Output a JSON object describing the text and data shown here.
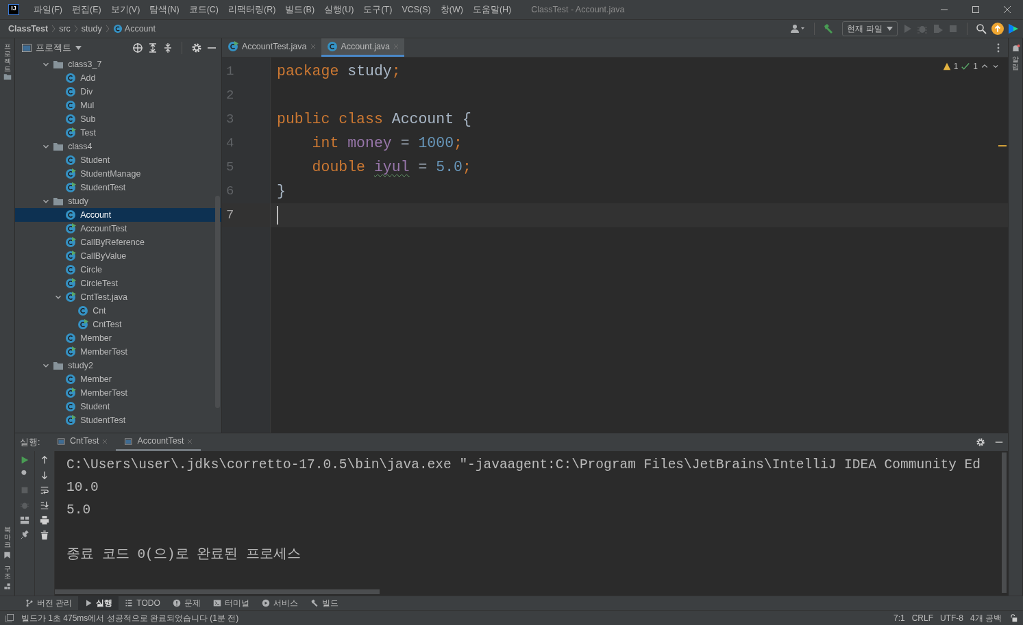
{
  "window": {
    "logo_text": "IJ",
    "menu": [
      "파일(F)",
      "편집(E)",
      "보기(V)",
      "탐색(N)",
      "코드(C)",
      "리팩터링(R)",
      "빌드(B)",
      "실행(U)",
      "도구(T)",
      "VCS(S)",
      "창(W)",
      "도움말(H)"
    ],
    "title": "ClassTest - Account.java"
  },
  "navbar": {
    "breadcrumbs": [
      "ClassTest",
      "src",
      "study",
      "Account"
    ],
    "run_config": "현재 파일"
  },
  "left_strip": {
    "top": [
      "프로젝트"
    ],
    "bottom": [
      "북마크",
      "구조"
    ]
  },
  "right_strip": {
    "label": "알림"
  },
  "project": {
    "title": "프로젝트",
    "tree": [
      {
        "label": "class3_7",
        "kind": "folder",
        "expanded": true,
        "selected": false,
        "children": [
          {
            "label": "Add",
            "kind": "class",
            "selected": false
          },
          {
            "label": "Div",
            "kind": "class",
            "selected": false
          },
          {
            "label": "Mul",
            "kind": "class",
            "selected": false
          },
          {
            "label": "Sub",
            "kind": "class",
            "selected": false
          },
          {
            "label": "Test",
            "kind": "main-class",
            "selected": false
          }
        ]
      },
      {
        "label": "class4",
        "kind": "folder",
        "expanded": true,
        "selected": false,
        "children": [
          {
            "label": "Student",
            "kind": "class",
            "selected": false
          },
          {
            "label": "StudentManage",
            "kind": "main-class",
            "selected": false
          },
          {
            "label": "StudentTest",
            "kind": "main-class",
            "selected": false
          }
        ]
      },
      {
        "label": "study",
        "kind": "folder",
        "expanded": true,
        "selected": false,
        "children": [
          {
            "label": "Account",
            "kind": "class",
            "selected": true
          },
          {
            "label": "AccountTest",
            "kind": "main-class",
            "selected": false
          },
          {
            "label": "CallByReference",
            "kind": "main-class",
            "selected": false
          },
          {
            "label": "CallByValue",
            "kind": "main-class",
            "selected": false
          },
          {
            "label": "Circle",
            "kind": "class",
            "selected": false
          },
          {
            "label": "CircleTest",
            "kind": "main-class",
            "selected": false
          },
          {
            "label": "CntTest.java",
            "kind": "file",
            "expanded": true,
            "selected": false,
            "children": [
              {
                "label": "Cnt",
                "kind": "class",
                "selected": false
              },
              {
                "label": "CntTest",
                "kind": "main-class",
                "selected": false
              }
            ]
          },
          {
            "label": "Member",
            "kind": "class",
            "selected": false
          },
          {
            "label": "MemberTest",
            "kind": "main-class",
            "selected": false
          }
        ]
      },
      {
        "label": "study2",
        "kind": "folder",
        "expanded": true,
        "selected": false,
        "children": [
          {
            "label": "Member",
            "kind": "class",
            "selected": false
          },
          {
            "label": "MemberTest",
            "kind": "main-class",
            "selected": false
          },
          {
            "label": "Student",
            "kind": "class",
            "selected": false
          },
          {
            "label": "StudentTest",
            "kind": "main-class",
            "selected": false
          }
        ]
      }
    ]
  },
  "editor": {
    "tabs": [
      {
        "label": "AccountTest.java",
        "kind": "main-class",
        "selected": false
      },
      {
        "label": "Account.java",
        "kind": "class",
        "selected": true
      }
    ],
    "inspections": {
      "warnings": "1",
      "weak_warnings": "1"
    },
    "lines": [
      {
        "number": "1",
        "current": false,
        "tokens": [
          {
            "text": "package",
            "kind": "keyword"
          },
          {
            "text": " study",
            "kind": "plain"
          },
          {
            "text": ";",
            "kind": "keyword"
          }
        ]
      },
      {
        "number": "2",
        "current": false
      },
      {
        "number": "3",
        "current": false,
        "tokens": [
          {
            "text": "public class",
            "kind": "keyword"
          },
          {
            "text": " Account {",
            "kind": "plain"
          }
        ]
      },
      {
        "number": "4",
        "current": false,
        "tokens": [
          {
            "text": "    int ",
            "kind": "keyword"
          },
          {
            "text": "money",
            "kind": "field"
          },
          {
            "text": " = ",
            "kind": "plain"
          },
          {
            "text": "1000",
            "kind": "number"
          },
          {
            "text": ";",
            "kind": "keyword"
          }
        ]
      },
      {
        "number": "5",
        "current": false,
        "tokens": [
          {
            "text": "    double ",
            "kind": "keyword"
          },
          {
            "text": "iyul",
            "kind": "misspelled-field"
          },
          {
            "text": " = ",
            "kind": "plain"
          },
          {
            "text": "5.0",
            "kind": "number"
          },
          {
            "text": ";",
            "kind": "keyword"
          }
        ]
      },
      {
        "number": "6",
        "current": false,
        "tokens": [
          {
            "text": "}",
            "kind": "plain"
          }
        ]
      },
      {
        "number": "7",
        "current": true
      }
    ]
  },
  "run": {
    "label": "실행:",
    "tabs": [
      {
        "label": "CntTest",
        "selected": false
      },
      {
        "label": "AccountTest",
        "selected": true
      }
    ],
    "console": [
      {
        "text": "C:\\Users\\user\\.jdks\\corretto-17.0.5\\bin\\java.exe \"-javaagent:C:\\Program Files\\JetBrains\\IntelliJ IDEA Community Ed",
        "kind": "command"
      },
      {
        "text": "10.0",
        "kind": "output"
      },
      {
        "text": "5.0",
        "kind": "output"
      },
      {
        "text": "종료 코드 0(으)로 완료된 프로세스",
        "kind": "exit"
      }
    ]
  },
  "tool_windows": [
    {
      "label": "버전 관리",
      "kind": "vcs",
      "selected": false
    },
    {
      "label": "실행",
      "kind": "run",
      "selected": true
    },
    {
      "label": "TODO",
      "kind": "todo",
      "selected": false
    },
    {
      "label": "문제",
      "kind": "problems",
      "selected": false
    },
    {
      "label": "터미널",
      "kind": "terminal",
      "selected": false
    },
    {
      "label": "서비스",
      "kind": "services",
      "selected": false
    },
    {
      "label": "빌드",
      "kind": "build",
      "selected": false
    }
  ],
  "status_bar": {
    "message": "빌드가 1초 475ms에서 성공적으로 완료되었습니다 (1분 전)",
    "position": "7:1",
    "line_separator": "CRLF",
    "encoding": "UTF-8",
    "indent": "4개 공백"
  }
}
